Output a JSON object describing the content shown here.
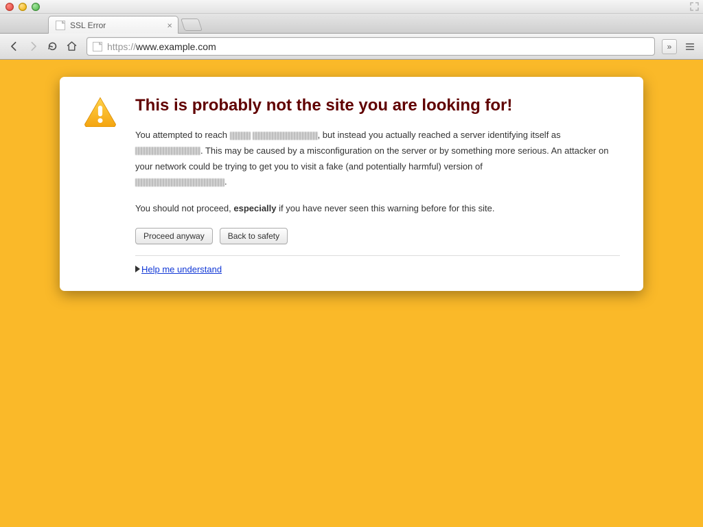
{
  "window": {
    "tab_title": "SSL Error"
  },
  "toolbar": {
    "url_scheme": "https://",
    "url_host": "www.example.com",
    "overflow_label": "»"
  },
  "error": {
    "heading": "This is probably not the site you are looking for!",
    "p1_a": "You attempted to reach ",
    "p1_b": ", but instead you actually reached a server identifying itself as ",
    "p1_c": ". This may be caused by a misconfiguration on the server or by something more serious. An attacker on your network could be trying to get you to visit a fake (and potentially harmful) version of ",
    "p1_d": ".",
    "p2_a": "You should not proceed, ",
    "p2_bold": "especially",
    "p2_b": " if you have never seen this warning before for this site.",
    "proceed_label": "Proceed anyway",
    "back_label": "Back to safety",
    "help_label": "Help me understand"
  }
}
